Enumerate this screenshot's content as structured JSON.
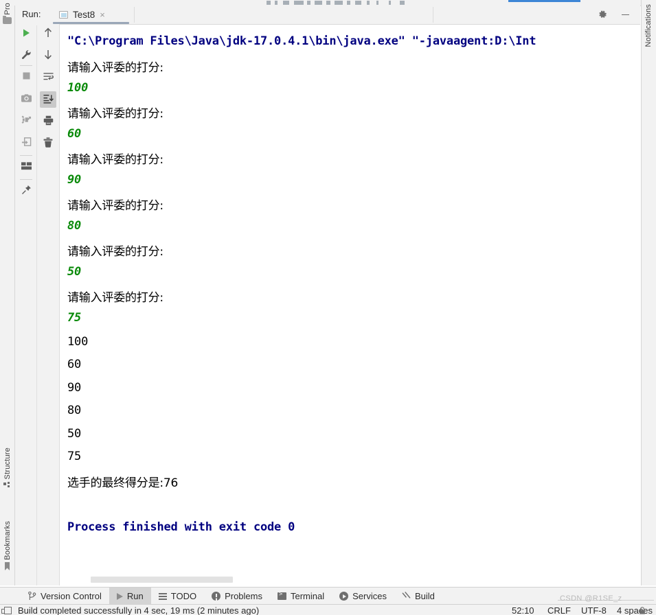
{
  "window": {
    "left_tool_tabs": [
      {
        "label": "Pro",
        "icon": "folder-icon"
      },
      {
        "label": "Structure",
        "icon": "structure-icon"
      },
      {
        "label": "Bookmarks",
        "icon": "bookmark-icon"
      }
    ],
    "right_tool_tabs": [
      {
        "label": "Notifications",
        "icon": "notifications-icon"
      }
    ]
  },
  "run_panel": {
    "title": "Run:",
    "tab": {
      "name": "Test8",
      "icon": "console-icon",
      "close": "×"
    },
    "header_actions": [
      {
        "name": "settings-button",
        "icon": "gear-icon"
      },
      {
        "name": "hide-button",
        "icon": "minimize-icon"
      }
    ],
    "toolbar_left": [
      {
        "name": "rerun-button",
        "icon": "run-icon",
        "tooltip": "Rerun"
      },
      {
        "name": "modify-run-configuration-button",
        "icon": "wrench-icon",
        "tooltip": "Modify Run Configuration"
      },
      {
        "name": "stop-button",
        "icon": "stop-icon",
        "tooltip": "Stop"
      },
      {
        "name": "screenshot-button",
        "icon": "camera-icon",
        "tooltip": "Screenshot"
      },
      {
        "name": "attach-debugger-button",
        "icon": "attach-icon",
        "tooltip": "Attach Debugger"
      },
      {
        "name": "import-button",
        "icon": "import-icon",
        "tooltip": "Import"
      },
      {
        "name": "layout-button",
        "icon": "layout-icon",
        "tooltip": "Layout Settings"
      },
      {
        "name": "pin-tab-button",
        "icon": "pin-icon",
        "tooltip": "Pin Tab"
      }
    ],
    "toolbar_right": [
      {
        "name": "up-the-stack-trace-button",
        "icon": "arrow-up-icon",
        "tooltip": "Up the Stack Trace"
      },
      {
        "name": "down-the-stack-trace-button",
        "icon": "arrow-down-icon",
        "tooltip": "Down the Stack Trace"
      },
      {
        "name": "soft-wrap-button",
        "icon": "soft-wrap-icon",
        "tooltip": "Soft-Wrap"
      },
      {
        "name": "scroll-to-end-button",
        "icon": "scroll-to-end-icon",
        "tooltip": "Scroll to the End",
        "selected": true
      },
      {
        "name": "print-button",
        "icon": "print-icon",
        "tooltip": "Print"
      },
      {
        "name": "clear-all-button",
        "icon": "trash-icon",
        "tooltip": "Clear All"
      }
    ]
  },
  "console": {
    "lines": [
      {
        "text": "\"C:\\Program Files\\Java\\jdk-17.0.4.1\\bin\\java.exe\" \"-javaagent:D:\\Int",
        "kind": "system"
      },
      {
        "text": "请输入评委的打分:",
        "kind": "cjk"
      },
      {
        "text": "100",
        "kind": "input"
      },
      {
        "text": "请输入评委的打分:",
        "kind": "cjk"
      },
      {
        "text": "60",
        "kind": "input"
      },
      {
        "text": "请输入评委的打分:",
        "kind": "cjk"
      },
      {
        "text": "90",
        "kind": "input"
      },
      {
        "text": "请输入评委的打分:",
        "kind": "cjk"
      },
      {
        "text": "80",
        "kind": "input"
      },
      {
        "text": "请输入评委的打分:",
        "kind": "cjk"
      },
      {
        "text": "50",
        "kind": "input"
      },
      {
        "text": "请输入评委的打分:",
        "kind": "cjk"
      },
      {
        "text": "75",
        "kind": "input"
      },
      {
        "text": "100",
        "kind": "output"
      },
      {
        "text": "60",
        "kind": "output"
      },
      {
        "text": "90",
        "kind": "output"
      },
      {
        "text": "80",
        "kind": "output"
      },
      {
        "text": "50",
        "kind": "output"
      },
      {
        "text": "75",
        "kind": "output"
      },
      {
        "text": "选手的最终得分是:76",
        "kind": "cjk"
      },
      {
        "text": "",
        "kind": "output"
      },
      {
        "text": "Process finished with exit code 0",
        "kind": "system"
      }
    ],
    "colors": {
      "system": "#000080",
      "output": "#000000",
      "input": "#0a8a0a",
      "background": "#ffffff"
    }
  },
  "bottom_tabs": [
    {
      "label": "Version Control",
      "icon": "branch-icon",
      "active": false
    },
    {
      "label": "Run",
      "icon": "run-gray-icon",
      "active": true
    },
    {
      "label": "TODO",
      "icon": "todo-icon",
      "active": false
    },
    {
      "label": "Problems",
      "icon": "problems-icon",
      "active": false
    },
    {
      "label": "Terminal",
      "icon": "terminal-icon",
      "active": false
    },
    {
      "label": "Services",
      "icon": "services-icon",
      "active": false
    },
    {
      "label": "Build",
      "icon": "hammer-icon",
      "active": false
    }
  ],
  "status_bar": {
    "message": "Build completed successfully in 4 sec, 19 ms (2 minutes ago)",
    "caret_position": "52:10",
    "line_separator": "CRLF",
    "encoding": "UTF-8",
    "indent": "4 spaces",
    "lock_icon": "lock-icon"
  },
  "watermark": "CSDN @R1SE_z"
}
